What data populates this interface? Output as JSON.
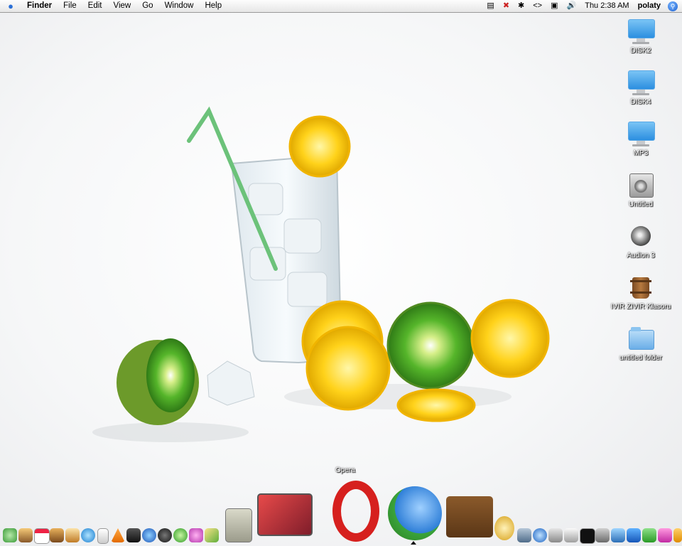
{
  "menubar": {
    "apple": "",
    "app_name": "Finder",
    "menus": [
      "File",
      "Edit",
      "View",
      "Go",
      "Window",
      "Help"
    ],
    "status": {
      "clock": "Thu 2:38 AM",
      "user": "polaty",
      "bluetooth_icon": "bluetooth-icon",
      "volume_icon": "volume-icon"
    }
  },
  "desktop": {
    "icons": [
      {
        "label": "DISK2",
        "icon": "monitor-icon"
      },
      {
        "label": "DISK4",
        "icon": "monitor-icon"
      },
      {
        "label": "MP3",
        "icon": "monitor-icon"
      },
      {
        "label": "Untitled",
        "icon": "hard-drive-icon"
      },
      {
        "label": "Audion 3",
        "icon": "speaker-icon"
      },
      {
        "label": "IVIR ZIVIR Klasoru",
        "icon": "bucket-icon"
      },
      {
        "label": "untitled folder",
        "icon": "folder-icon"
      }
    ]
  },
  "dock": {
    "hover_label": "Opera",
    "colors": {
      "opera": "#d6201e",
      "messenger": "#2f7fd8"
    }
  }
}
